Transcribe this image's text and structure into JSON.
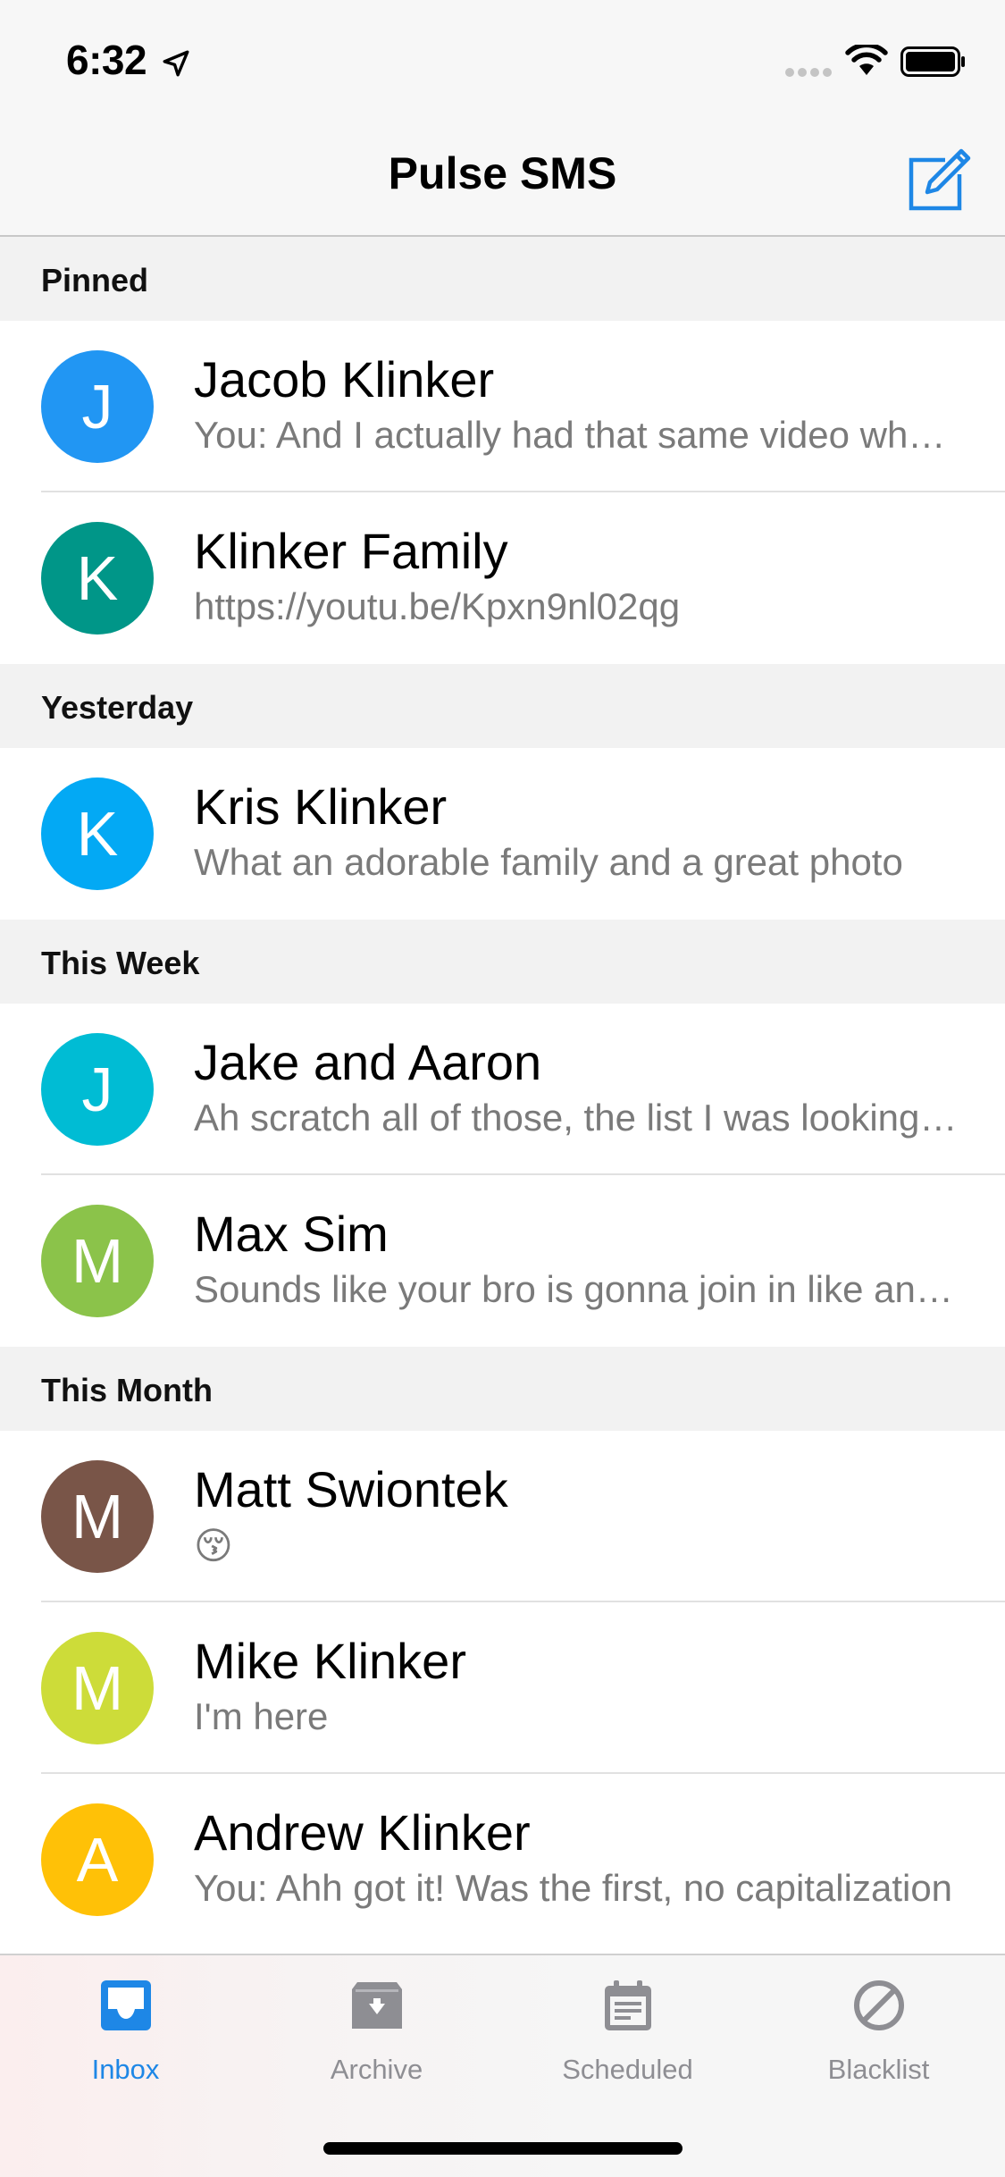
{
  "status": {
    "time": "6:32"
  },
  "nav": {
    "title": "Pulse SMS"
  },
  "colors": {
    "accent": "#1e87e6",
    "tab_inactive": "#8e8e93"
  },
  "sections": [
    {
      "title": "Pinned",
      "conversations": [
        {
          "initial": "J",
          "name": "Jacob Klinker",
          "preview": "You: And I actually had that same video when I first tried",
          "color": "#2196f3"
        },
        {
          "initial": "K",
          "name": "Klinker Family",
          "preview": "https://youtu.be/Kpxn9nl02qg",
          "color": "#009688"
        }
      ]
    },
    {
      "title": "Yesterday",
      "conversations": [
        {
          "initial": "K",
          "name": "Kris Klinker",
          "preview": "What an adorable family and a great photo",
          "color": "#03a9f4"
        }
      ]
    },
    {
      "title": "This Week",
      "conversations": [
        {
          "initial": "J",
          "name": "Jake and Aaron",
          "preview": "Ah scratch all of those, the list I was looking at",
          "color": "#00bcd4"
        },
        {
          "initial": "M",
          "name": "Max Sim",
          "preview": "Sounds like your bro is gonna join in like an hour",
          "color": "#8bc34a"
        }
      ]
    },
    {
      "title": "This Month",
      "conversations": [
        {
          "initial": "M",
          "name": "Matt Swiontek",
          "preview": "😚",
          "color": "#795548"
        },
        {
          "initial": "M",
          "name": "Mike Klinker",
          "preview": "I'm here",
          "color": "#cddc39"
        },
        {
          "initial": "A",
          "name": "Andrew Klinker",
          "preview": "You: Ahh got it! Was the first, no capitalization",
          "color": "#ffc107"
        }
      ]
    }
  ],
  "tabs": [
    {
      "label": "Inbox",
      "icon": "inbox-icon",
      "active": true
    },
    {
      "label": "Archive",
      "icon": "archive-icon",
      "active": false
    },
    {
      "label": "Scheduled",
      "icon": "scheduled-icon",
      "active": false
    },
    {
      "label": "Blacklist",
      "icon": "blacklist-icon",
      "active": false
    }
  ]
}
